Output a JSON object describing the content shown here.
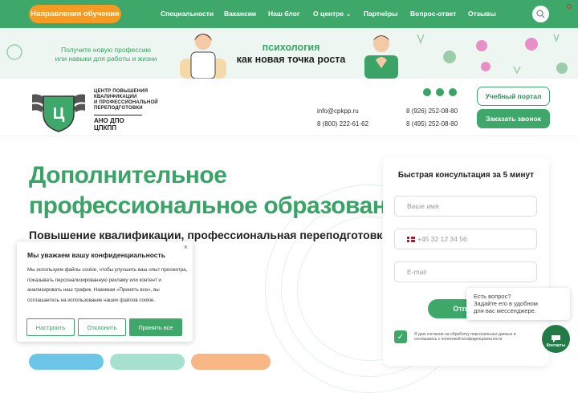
{
  "nav": {
    "directions_button": "Направления обучения",
    "items": [
      "Специальности",
      "Вакансии",
      "Наш блог",
      "О центре",
      "Партнёры",
      "Вопрос-ответ",
      "Отзывы"
    ]
  },
  "banner": {
    "left_line1": "Получите новую профессию",
    "left_line2": "или навыки для работы и жизни",
    "headline_line1": "психология",
    "headline_line2": "как новая точка роста"
  },
  "header": {
    "logo_line1": "ЦЕНТР ПОВЫШЕНИЯ",
    "logo_line2": "КВАЛИФИКАЦИИ",
    "logo_line3": "И ПРОФЕССИОНАЛЬНОЙ",
    "logo_line4": "ПЕРЕПОДГОТОВКИ",
    "logo_org": "АНО ДПО ЦПКПП",
    "email": "info@cpkpp.ru",
    "phone_free": "8 (800) 222-61-62",
    "phone_mobile": "8 (926) 252-08-80",
    "phone_office": "8 (495) 252-08-80",
    "portal_button": "Учебный портал",
    "call_button": "Заказать звонок"
  },
  "hero": {
    "title_line1": "Дополнительное",
    "title_line2": "профессиональное образование",
    "subtitle": "Повышение квалификации, профессиональная переподготовка,"
  },
  "form": {
    "title": "Быстрая консультация за 5 минут",
    "name_placeholder": "Ваше имя",
    "phone_placeholder": "+45 32 12 34 56",
    "email_placeholder": "E-mail",
    "submit_partial": "Отпра",
    "agree_text": "Я даю согласие на обработку персональных данных и соглашаюсь с политикой конфиденциальности"
  },
  "cookie": {
    "title": "Мы уважаем вашу конфиденциальность",
    "text": "Мы используем файлы cookie, чтобы улучшить ваш опыт просмотра, показывать персонализированную рекламу или контент и анализировать наш трафик. Нажимая «Принять все», вы соглашаетесь на использование наших файлов cookie.",
    "settings": "Настроить",
    "reject": "Отклонить",
    "accept": "Принять все",
    "close": "×"
  },
  "chat": {
    "popup_line1": "Есть вопрос?",
    "popup_line2": "Задайте его в удобном",
    "popup_line3": "для вас мессенджере.",
    "button_label": "Контакты"
  },
  "colors": {
    "brand_green": "#3da86a",
    "accent_orange": "#f59a23"
  }
}
